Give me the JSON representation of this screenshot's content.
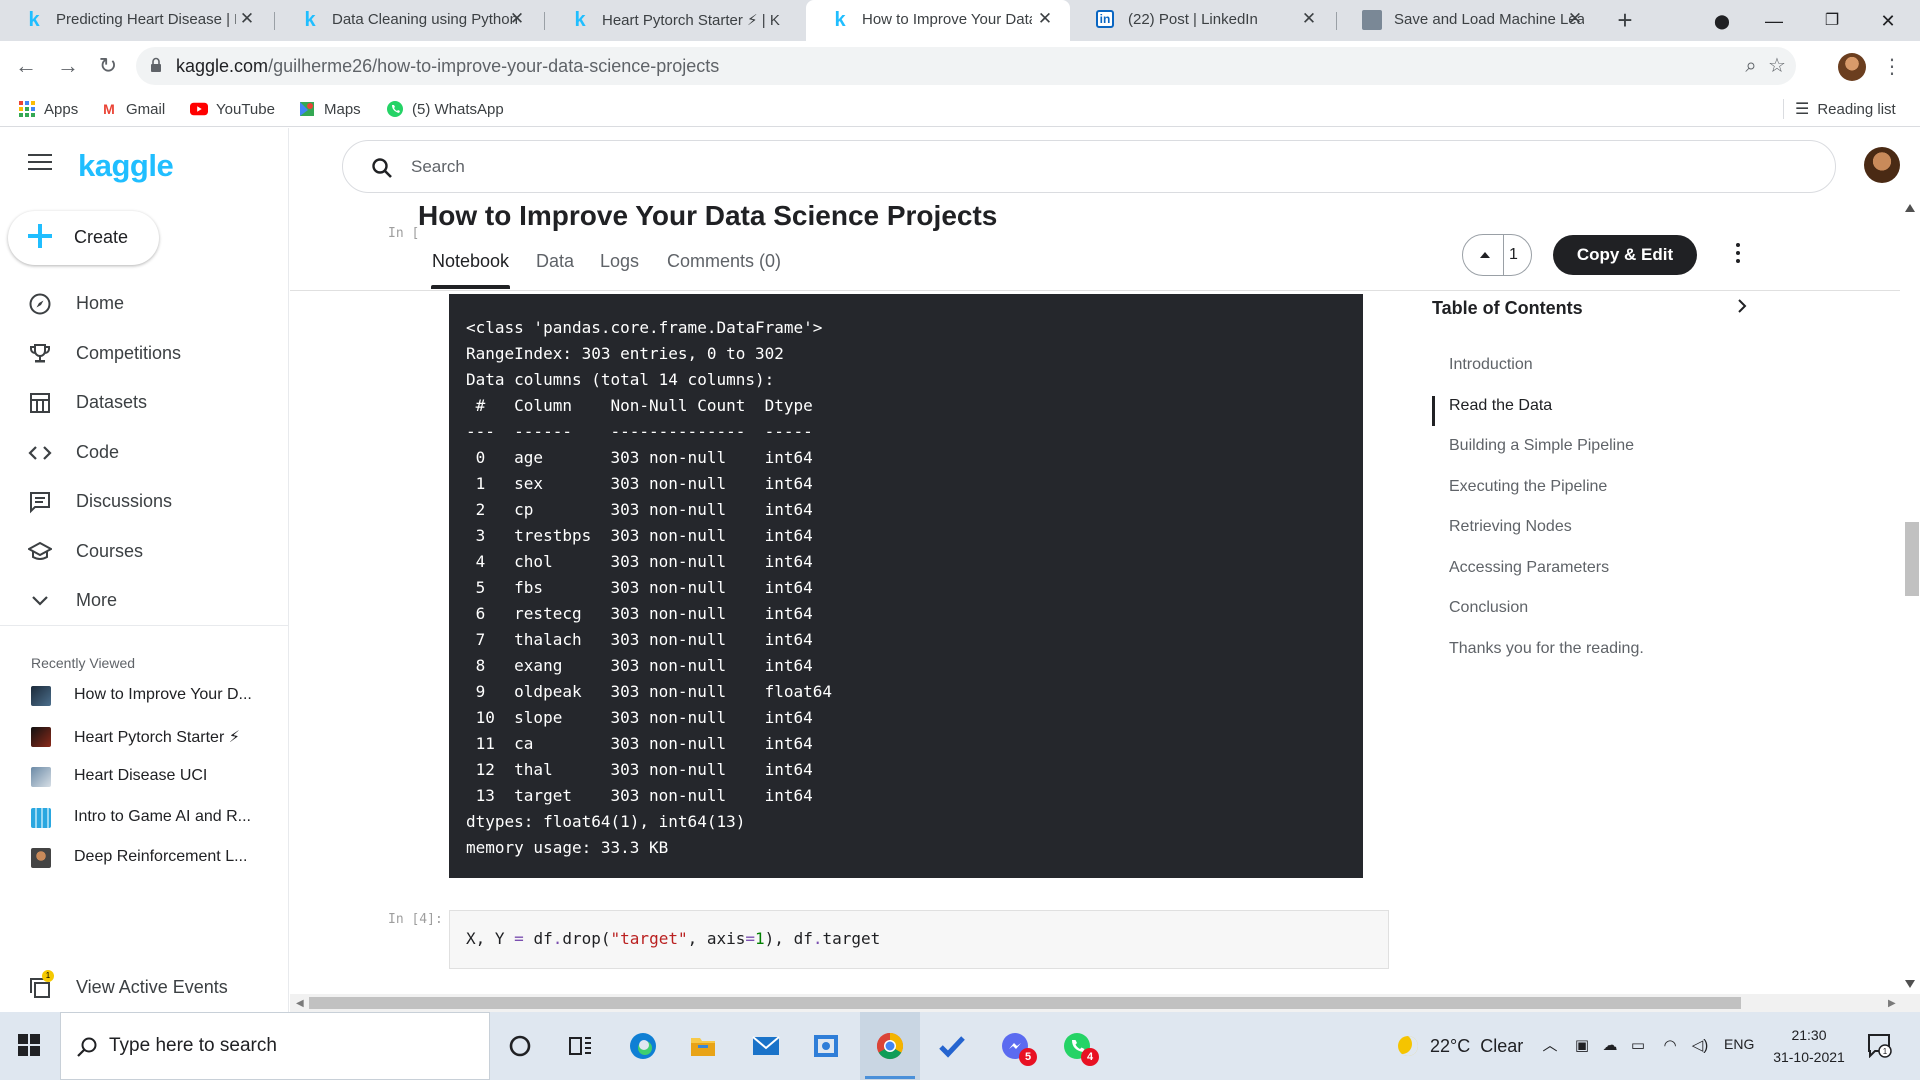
{
  "browser": {
    "tabs": [
      {
        "title": "Predicting Heart Disease | K",
        "icon": "kaggle-k-icon",
        "active": false
      },
      {
        "title": "Data Cleaning using Python",
        "icon": "kaggle-k-icon",
        "active": false
      },
      {
        "title": "Heart Pytorch Starter ⚡ | K",
        "icon": "kaggle-k-icon",
        "active": false
      },
      {
        "title": "How to Improve Your Data S",
        "icon": "kaggle-k-icon",
        "active": true
      },
      {
        "title": "(22) Post | LinkedIn",
        "icon": "linkedin-icon",
        "active": false
      },
      {
        "title": "Save and Load Machine Lea",
        "icon": "generic-page-icon",
        "active": false
      }
    ],
    "url_host": "kaggle.com",
    "url_path": "/guilherme26/how-to-improve-your-data-science-projects",
    "bookmarks": [
      {
        "label": "Apps",
        "icon": "apps-grid-icon"
      },
      {
        "label": "Gmail",
        "icon": "gmail-icon"
      },
      {
        "label": "YouTube",
        "icon": "youtube-icon"
      },
      {
        "label": "Maps",
        "icon": "maps-icon"
      },
      {
        "label": "(5) WhatsApp",
        "icon": "whatsapp-icon"
      }
    ],
    "reading_list_label": "Reading list"
  },
  "sidebar": {
    "logo": "kaggle",
    "create_label": "Create",
    "nav": [
      {
        "label": "Home",
        "icon": "compass-icon"
      },
      {
        "label": "Competitions",
        "icon": "trophy-icon"
      },
      {
        "label": "Datasets",
        "icon": "table-icon"
      },
      {
        "label": "Code",
        "icon": "code-icon"
      },
      {
        "label": "Discussions",
        "icon": "discussion-icon"
      },
      {
        "label": "Courses",
        "icon": "graduation-cap-icon"
      },
      {
        "label": "More",
        "icon": "chevron-down-icon"
      }
    ],
    "recent_heading": "Recently Viewed",
    "recent": [
      {
        "label": "How to Improve Your D..."
      },
      {
        "label": "Heart Pytorch Starter ⚡"
      },
      {
        "label": "Heart Disease UCI"
      },
      {
        "label": "Intro to Game AI and R..."
      },
      {
        "label": "Deep Reinforcement L..."
      }
    ],
    "active_events_label": "View Active Events",
    "active_events_badge": "1"
  },
  "main": {
    "search_placeholder": "Search",
    "notebook_title": "How to Improve Your Data Science Projects",
    "in_prompt_top": "In [",
    "tabs": [
      {
        "label": "Notebook",
        "active": true
      },
      {
        "label": "Data",
        "active": false
      },
      {
        "label": "Logs",
        "active": false
      },
      {
        "label": "Comments (0)",
        "active": false
      }
    ],
    "vote_count": "1",
    "copy_edit_label": "Copy & Edit",
    "output_lines": [
      "<class 'pandas.core.frame.DataFrame'>",
      "RangeIndex: 303 entries, 0 to 302",
      "Data columns (total 14 columns):",
      " #   Column    Non-Null Count  Dtype",
      "---  ------    --------------  -----",
      " 0   age       303 non-null    int64",
      " 1   sex       303 non-null    int64",
      " 2   cp        303 non-null    int64",
      " 3   trestbps  303 non-null    int64",
      " 4   chol      303 non-null    int64",
      " 5   fbs       303 non-null    int64",
      " 6   restecg   303 non-null    int64",
      " 7   thalach   303 non-null    int64",
      " 8   exang     303 non-null    int64",
      " 9   oldpeak   303 non-null    float64",
      " 10  slope     303 non-null    int64",
      " 11  ca        303 non-null    int64",
      " 12  thal      303 non-null    int64",
      " 13  target    303 non-null    int64",
      "dtypes: float64(1), int64(13)",
      "memory usage: 33.3 KB"
    ],
    "in_prompt_4": "In [4]:",
    "code": {
      "p1": "X, Y ",
      "op1": "=",
      "p2": " df",
      "op2": ".",
      "p3": "drop(",
      "s1": "\"target\"",
      "p4": ", axis",
      "op3": "=",
      "n1": "1",
      "p5": "), df",
      "op4": ".",
      "p6": "target"
    },
    "toc": {
      "heading": "Table of Contents",
      "items": [
        {
          "label": "Introduction",
          "active": false
        },
        {
          "label": "Read the Data",
          "active": true
        },
        {
          "label": "Building a Simple Pipeline",
          "active": false
        },
        {
          "label": "Executing the Pipeline",
          "active": false
        },
        {
          "label": "Retrieving Nodes",
          "active": false
        },
        {
          "label": "Accessing Parameters",
          "active": false
        },
        {
          "label": "Conclusion",
          "active": false
        },
        {
          "label": "Thanks you for the reading.",
          "active": false
        }
      ]
    }
  },
  "taskbar": {
    "search_label": "Type here to search",
    "apps": [
      {
        "name": "cortana-icon"
      },
      {
        "name": "task-view-icon"
      },
      {
        "name": "edge-icon"
      },
      {
        "name": "file-explorer-icon"
      },
      {
        "name": "mail-icon"
      },
      {
        "name": "photos-icon"
      },
      {
        "name": "chrome-icon",
        "active": true
      },
      {
        "name": "todo-icon"
      },
      {
        "name": "messenger-icon",
        "badge": "5"
      },
      {
        "name": "whatsapp-icon",
        "badge": "4"
      }
    ],
    "weather": "22°C  Clear",
    "lang": "ENG",
    "time": "21:30",
    "date": "31-10-2021"
  },
  "colors": {
    "kaggle_blue": "#20beff",
    "output_bg": "#25272c",
    "button_dark": "#202124"
  }
}
